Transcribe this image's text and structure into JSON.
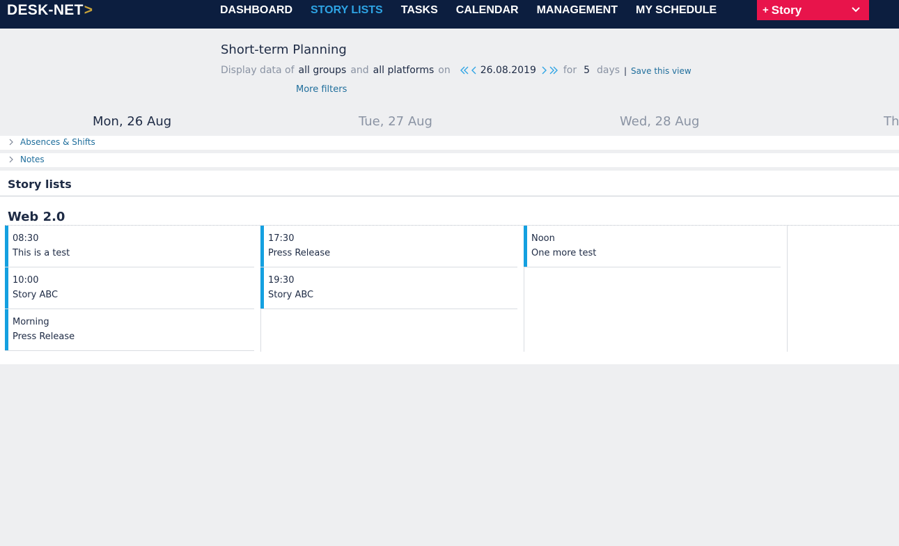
{
  "app": {
    "logo_text": "DESK-NET",
    "logo_chevron": ">"
  },
  "nav": {
    "items": [
      {
        "label": "DASHBOARD",
        "active": false
      },
      {
        "label": "STORY LISTS",
        "active": true
      },
      {
        "label": "TASKS",
        "active": false
      },
      {
        "label": "CALENDAR",
        "active": false
      },
      {
        "label": "MANAGEMENT",
        "active": false
      },
      {
        "label": "MY SCHEDULE",
        "active": false
      }
    ],
    "story_button": {
      "plus": "+",
      "label": "Story"
    }
  },
  "header": {
    "title": "Short-term Planning",
    "filter": {
      "display_data_of": "Display data of",
      "groups": "all groups",
      "and": "and",
      "platforms": "all platforms",
      "on": "on",
      "date": "26.08.2019",
      "for": "for",
      "days_count": "5",
      "days": "days"
    },
    "save_view": "Save this view",
    "more_filters": "More filters"
  },
  "days": [
    {
      "label": "Mon, 26 Aug",
      "today": true
    },
    {
      "label": "Tue, 27 Aug",
      "today": false
    },
    {
      "label": "Wed, 28 Aug",
      "today": false
    },
    {
      "label": "Th",
      "today": false
    }
  ],
  "sections": {
    "absences": "Absences & Shifts",
    "notes": "Notes"
  },
  "story_lists": {
    "title": "Story lists",
    "group": "Web 2.0",
    "columns": [
      [
        {
          "time": "08:30",
          "title": "This is a test"
        },
        {
          "time": "10:00",
          "title": "Story ABC"
        },
        {
          "time": "Morning",
          "title": "Press Release"
        }
      ],
      [
        {
          "time": "17:30",
          "title": "Press Release"
        },
        {
          "time": "19:30",
          "title": "Story ABC"
        }
      ],
      [
        {
          "time": "Noon",
          "title": "One more test"
        }
      ]
    ]
  },
  "colors": {
    "nav_bg": "#0c1e3f",
    "nav_active": "#2ea4e4",
    "story_button": "#e8144b",
    "card_accent": "#14a0e0",
    "link": "#1f6e9c"
  }
}
